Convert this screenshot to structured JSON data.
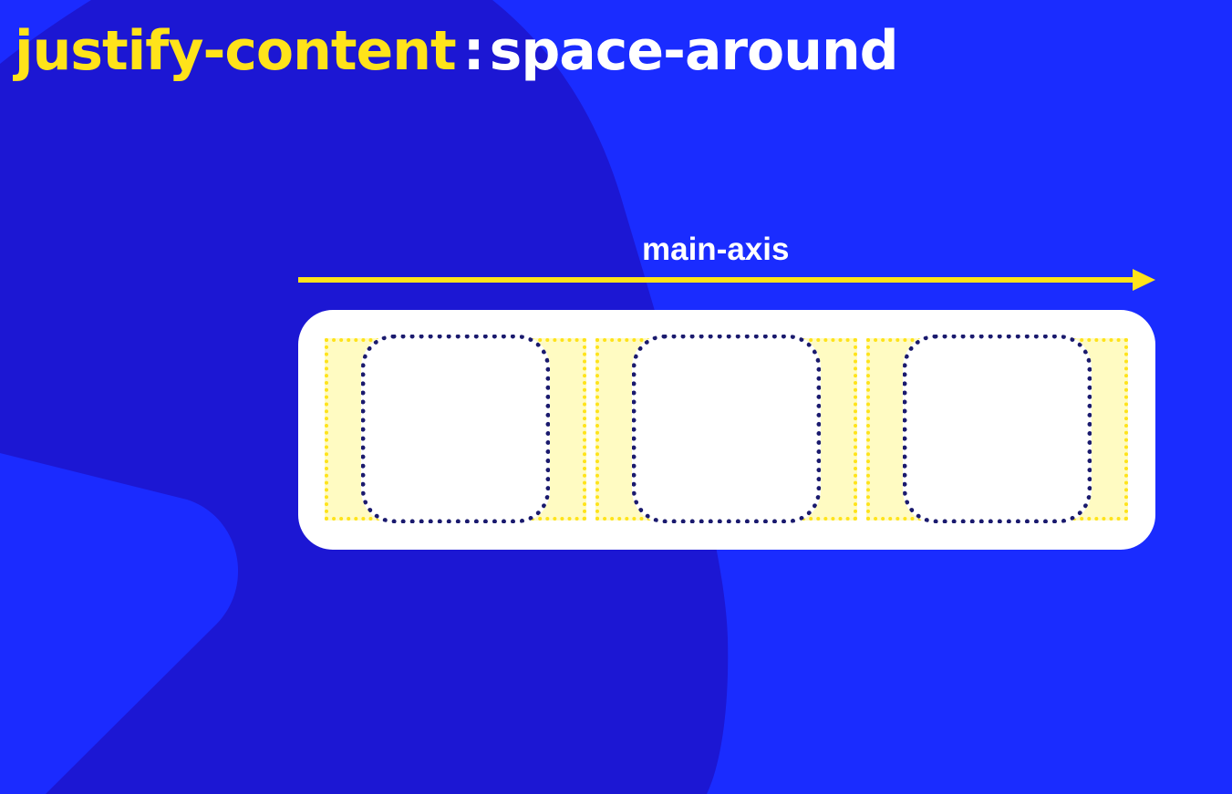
{
  "title": {
    "property": "justify-content",
    "separator": ":",
    "value": "space-around"
  },
  "axis": {
    "label": "main-axis"
  },
  "items": [
    {
      "id": "item-1"
    },
    {
      "id": "item-2"
    },
    {
      "id": "item-3"
    }
  ],
  "colors": {
    "background": "#1a2cff",
    "background_blob": "#1c17d3",
    "background_shape_light": "#1b2bff",
    "title_property": "#ffe31a",
    "title_value": "#ffffff",
    "axis": "#ffe31a",
    "axis_label": "#ffffff",
    "container": "#ffffff",
    "slot_fill": "#fffbc2",
    "slot_border": "#ffe31a",
    "item_fill": "#ffffff",
    "item_border": "#1a1a6e"
  }
}
